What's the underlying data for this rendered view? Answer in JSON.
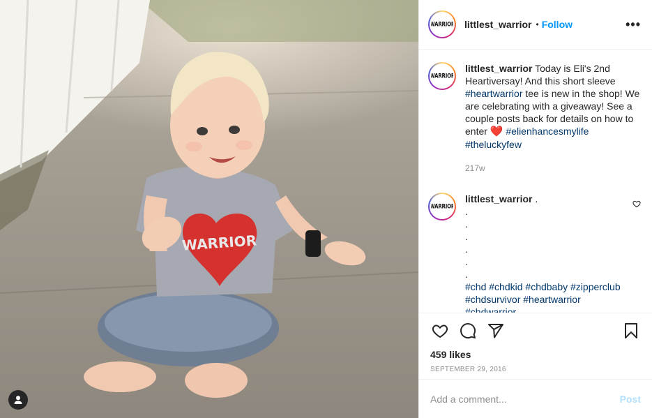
{
  "photo": {
    "alt": "Toddler sitting on a sidewalk wearing a Warrior heart tee"
  },
  "header": {
    "username": "littlest_warrior",
    "separator": "•",
    "follow_label": "Follow",
    "more_label": "•••",
    "avatar_logo": "WARRIOR"
  },
  "caption": {
    "username": "littlest_warrior",
    "text_1": "Today is Eli's 2nd Heartiversay! And this short sleeve",
    "hashtag_1": "#heartwarrior",
    "text_2": "tee is new in the shop! We are celebrating with a giveaway! See a couple posts back for details on how to enter",
    "emoji": "❤️",
    "hashtag_2": "#elienhancesmylife",
    "hashtag_3": "#theluckyfew",
    "time": "217w"
  },
  "comment": {
    "username": "littlest_warrior",
    "text": ".",
    "dots": [
      ".",
      ".",
      ".",
      ".",
      ".",
      "."
    ],
    "hashtags": [
      "#chd",
      "#chdkid",
      "#chdbaby",
      "#zipperclub",
      "#chdsurvivor",
      "#heartwarrior",
      "#chdwarrior"
    ]
  },
  "actions": {
    "likes": "459 likes",
    "date": "SEPTEMBER 29, 2016"
  },
  "add_comment": {
    "placeholder": "Add a comment...",
    "post_label": "Post"
  },
  "colors": {
    "link": "#0095f6",
    "hashtag": "#00376b",
    "muted": "#8e8e8e",
    "post_disabled": "#b2dffc"
  }
}
